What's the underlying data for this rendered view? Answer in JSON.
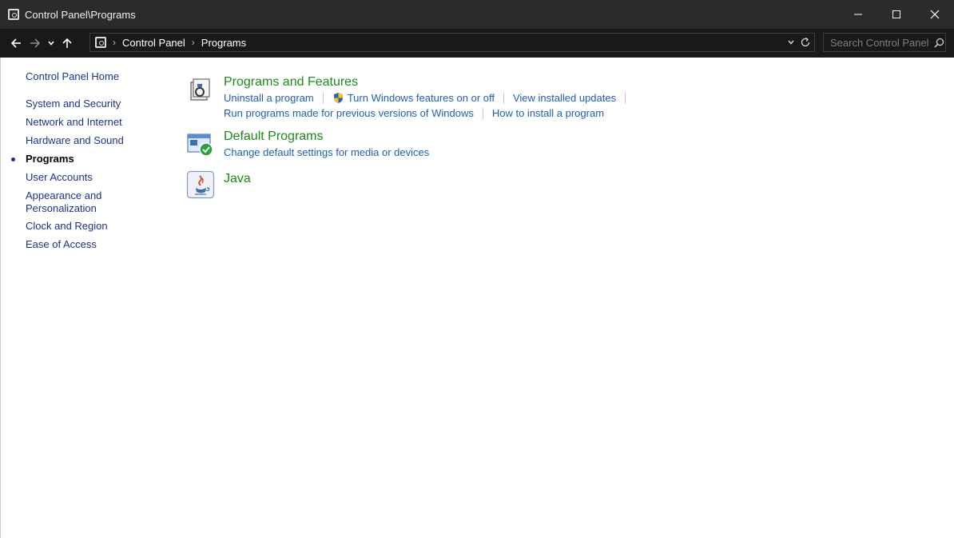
{
  "window": {
    "title": "Control Panel\\Programs"
  },
  "address": {
    "crumbs": [
      "Control Panel",
      "Programs"
    ]
  },
  "search": {
    "placeholder": "Search Control Panel"
  },
  "sidebar": {
    "home_label": "Control Panel Home",
    "items": [
      {
        "label": "System and Security"
      },
      {
        "label": "Network and Internet"
      },
      {
        "label": "Hardware and Sound"
      },
      {
        "label": "Programs",
        "active": true
      },
      {
        "label": "User Accounts"
      },
      {
        "label": "Appearance and Personalization"
      },
      {
        "label": "Clock and Region"
      },
      {
        "label": "Ease of Access"
      }
    ]
  },
  "categories": {
    "programs_features": {
      "title": "Programs and Features",
      "links": [
        "Uninstall a program",
        "Turn Windows features on or off",
        "View installed updates",
        "Run programs made for previous versions of Windows",
        "How to install a program"
      ]
    },
    "default_programs": {
      "title": "Default Programs",
      "links": [
        "Change default settings for media or devices"
      ]
    },
    "java": {
      "title": "Java"
    }
  },
  "colors": {
    "titlebar": "#2b2b2b",
    "addressbar": "#191919",
    "category_title": "#1a8a1a",
    "link": "#1f5fb4",
    "nav_link": "#1e3287"
  }
}
